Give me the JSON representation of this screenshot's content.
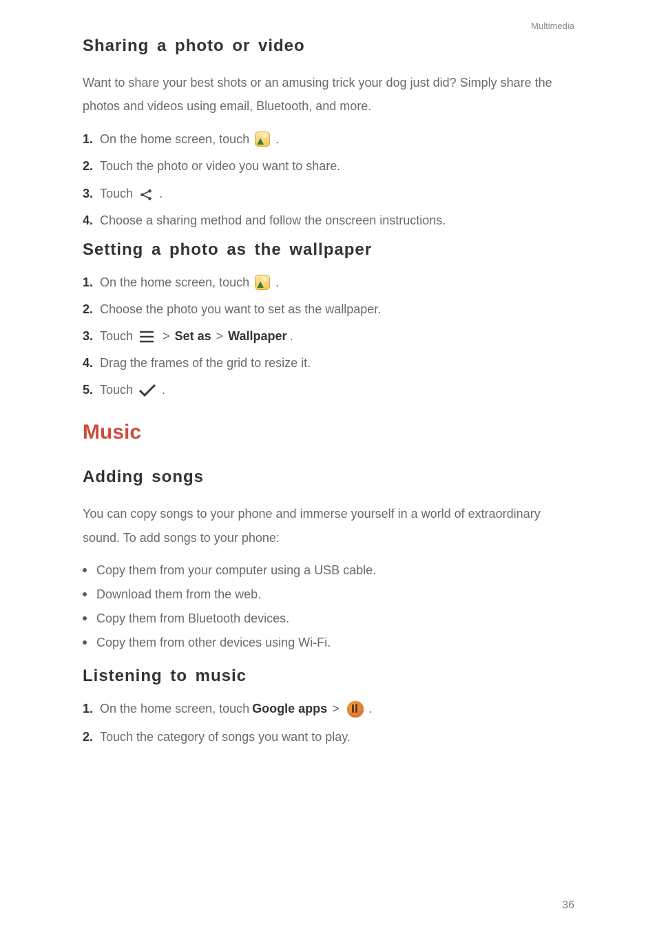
{
  "header": {
    "section_label": "Multimedia"
  },
  "sec1": {
    "title": "Sharing a photo or video",
    "intro": "Want to share your best shots or an amusing trick your dog just did? Simply share the photos and videos using email, Bluetooth, and more.",
    "steps": {
      "n1": "1.",
      "s1a": "On the home screen, touch",
      "s1b": ".",
      "n2": "2.",
      "s2": "Touch the photo or video you want to share.",
      "n3": "3.",
      "s3a": "Touch",
      "s3b": ".",
      "n4": "4.",
      "s4": "Choose a sharing method and follow the onscreen instructions."
    }
  },
  "sec2": {
    "title": "Setting a photo as the wallpaper",
    "steps": {
      "n1": "1.",
      "s1a": "On the home screen, touch",
      "s1b": ".",
      "n2": "2.",
      "s2": "Choose the photo you want to set as the wallpaper.",
      "n3": "3.",
      "s3a": "Touch",
      "gt1": ">",
      "setas": "Set as",
      "gt2": ">",
      "wallpaper": "Wallpaper",
      "s3end": ".",
      "n4": "4.",
      "s4": "Drag the frames of the grid to resize it.",
      "n5": "5.",
      "s5a": "Touch",
      "s5b": "."
    }
  },
  "music": {
    "title": "Music",
    "adding": {
      "title": "Adding songs",
      "intro": "You can copy songs to your phone and immerse yourself in a world of extraordinary sound. To add songs to your phone:",
      "b1": "Copy them from your computer using a USB cable.",
      "b2": "Download them from the web.",
      "b3": "Copy them from Bluetooth devices.",
      "b4": "Copy them from other devices using Wi-Fi."
    },
    "listening": {
      "title": "Listening to music",
      "n1": "1.",
      "s1a": "On the home screen, touch",
      "googleapps": "Google apps",
      "gt": ">",
      "s1b": ".",
      "n2": "2.",
      "s2": "Touch the category of songs you want to play."
    }
  },
  "page_number": "36"
}
